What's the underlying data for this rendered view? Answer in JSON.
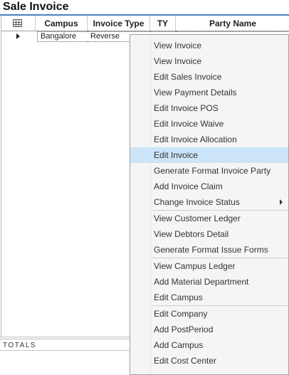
{
  "page_title": "Sale Invoice",
  "grid": {
    "columns": {
      "campus": "Campus",
      "invoice_type": "Invoice Type",
      "ty": "TY",
      "party_name": "Party Name"
    },
    "rows": [
      {
        "campus": "Bangalore",
        "invoice_type": "Reverse",
        "ty": "",
        "party_name": ""
      }
    ]
  },
  "totals_label": "TOTALS",
  "context_menu": {
    "items": [
      {
        "label": "View Invoice"
      },
      {
        "label": "View Invoice"
      },
      {
        "label": "Edit Sales Invoice"
      },
      {
        "label": "View Payment Details"
      },
      {
        "label": "Edit Invoice POS"
      },
      {
        "label": "Edit Invoice Waive"
      },
      {
        "label": "Edit Invoice Allocation"
      },
      {
        "label": "Edit Invoice",
        "highlighted": true
      },
      {
        "label": "Generate Format Invoice Party"
      },
      {
        "label": "Add Invoice Claim"
      },
      {
        "label": "Change Invoice Status",
        "has_submenu": true
      },
      {
        "label": "View Customer Ledger"
      },
      {
        "label": "View Debtors Detail"
      },
      {
        "label": "Generate Format Issue Forms"
      },
      {
        "label": "View Campus Ledger"
      },
      {
        "label": "Add Material Department"
      },
      {
        "label": "Edit Campus"
      },
      {
        "label": "Edit Company"
      },
      {
        "label": "Add PostPeriod"
      },
      {
        "label": "Add Campus"
      },
      {
        "label": "Edit Cost Center"
      }
    ]
  },
  "colors": {
    "title_underline": "#4a7fc2",
    "menu_highlight": "#cce4f7",
    "menu_background": "#f5f5f5"
  }
}
